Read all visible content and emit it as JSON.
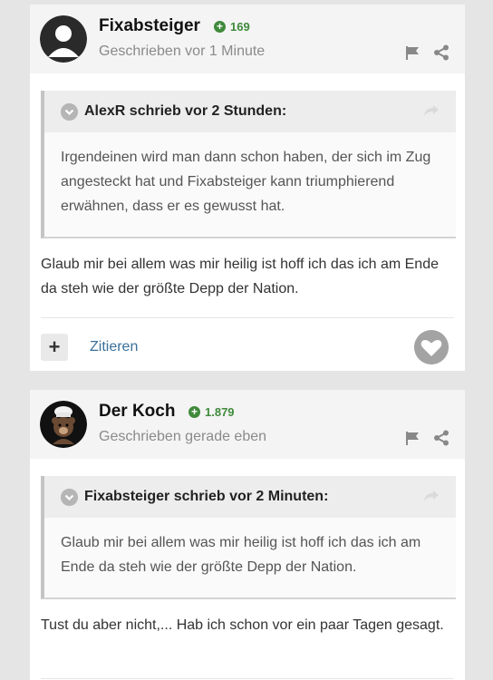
{
  "colors": {
    "background": "#e5e5e5",
    "post_bg": "#ffffff",
    "header_bg": "#f4f4f4",
    "reputation": "#3f8a3b",
    "link": "#3a6f99",
    "muted": "#8a8a8a"
  },
  "posts": [
    {
      "author": "Fixabsteiger",
      "avatar_icon": "default-user-avatar",
      "reputation": "169",
      "posted": "Geschrieben vor 1 Minute",
      "quote": {
        "citation": "AlexR schrieb vor 2 Stunden:",
        "text": "Irgendeinen wird man dann schon haben, der sich im Zug angesteckt hat und Fixabsteiger kann triumphierend erwähnen, dass er es gewusst hat."
      },
      "text": "Glaub mir bei allem was mir heilig ist hoff ich das ich am Ende da steh wie der größte Depp der Nation.",
      "actions": {
        "plus": "+",
        "quote_label": "Zitieren"
      }
    },
    {
      "author": "Der Koch",
      "avatar_icon": "chef-bear-avatar",
      "reputation": "1.879",
      "posted": "Geschrieben gerade eben",
      "quote": {
        "citation": "Fixabsteiger schrieb vor 2 Minuten:",
        "text": "Glaub mir bei allem was mir heilig ist hoff ich das ich am Ende da steh wie der größte Depp der Nation."
      },
      "text": "Tust du aber nicht,... Hab ich schon vor ein paar Tagen gesagt."
    }
  ]
}
